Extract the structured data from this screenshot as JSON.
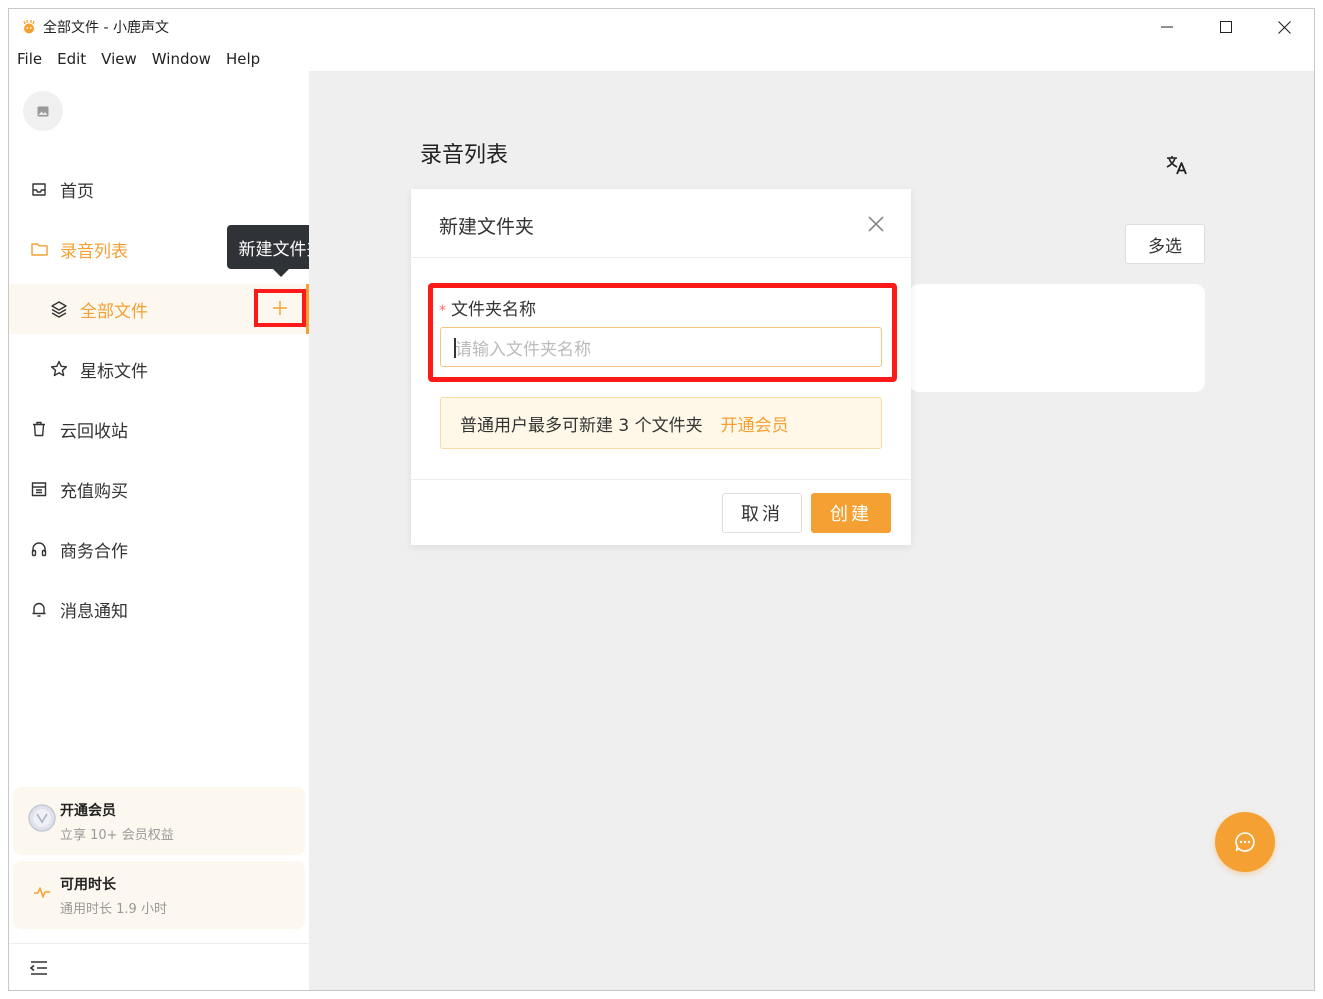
{
  "window": {
    "title": "全部文件 - 小鹿声文",
    "icon": "deer-logo-icon"
  },
  "menu": [
    "File",
    "Edit",
    "View",
    "Window",
    "Help"
  ],
  "sidebar": {
    "items": [
      {
        "label": "首页",
        "icon": "inbox-icon"
      },
      {
        "label": "录音列表",
        "icon": "folder-icon"
      },
      {
        "label": "全部文件",
        "icon": "layers-icon"
      },
      {
        "label": "星标文件",
        "icon": "star-icon"
      },
      {
        "label": "云回收站",
        "icon": "trash-icon"
      },
      {
        "label": "充值购买",
        "icon": "store-icon"
      },
      {
        "label": "商务合作",
        "icon": "headphones-icon"
      },
      {
        "label": "消息通知",
        "icon": "bell-icon"
      }
    ],
    "tooltip": "新建文件夹",
    "cards": {
      "vip": {
        "title": "开通会员",
        "subtitle": "立享 10+ 会员权益"
      },
      "time": {
        "title": "可用时长",
        "subtitle": "通用时长 1.9 小时"
      }
    }
  },
  "main": {
    "page_title": "录音列表",
    "multi_select_label": "多选"
  },
  "modal": {
    "title": "新建文件夹",
    "field_label": "文件夹名称",
    "required_mark": "*",
    "input_placeholder": "请输入文件夹名称",
    "input_value": "",
    "notice_text": "普通用户最多可新建 3 个文件夹",
    "notice_link": "开通会员",
    "cancel_label": "取消",
    "create_label": "创建"
  },
  "colors": {
    "accent": "#f5a033",
    "highlight": "#ff1a1a",
    "tooltip_bg": "#2f3236"
  }
}
